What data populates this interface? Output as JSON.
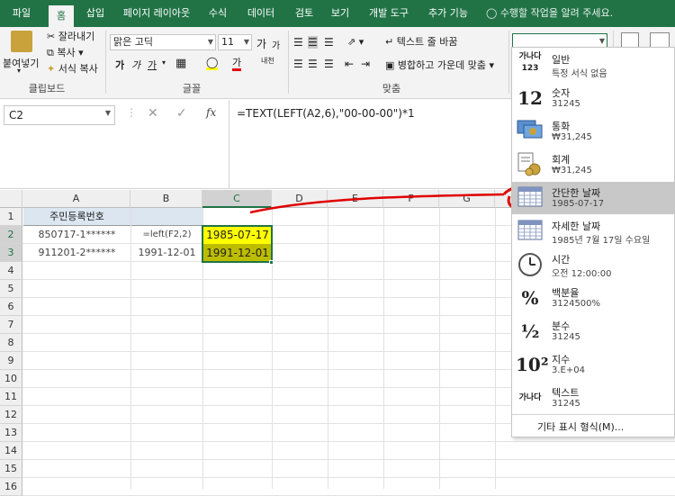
{
  "ribbon_tabs": [
    "파일",
    "홈",
    "삽입",
    "페이지 레이아웃",
    "수식",
    "데이터",
    "검토",
    "보기",
    "개발 도구",
    "추가 기능"
  ],
  "tell_me": "수행할 작업을 알려 주세요.",
  "clipboard": {
    "paste": "붙여넣기",
    "cut": "잘라내기",
    "copy": "복사",
    "format_painter": "서식 복사",
    "group": "클립보드"
  },
  "font": {
    "name": "맑은 고딕",
    "size": "11",
    "group": "글꼴",
    "bold": "가",
    "italic": "가",
    "underline": "가",
    "grow": "가",
    "shrink": "가",
    "fill_label": "가",
    "ruby": "내천"
  },
  "alignment": {
    "wrap": "텍스트 줄 바꿈",
    "merge": "병합하고 가운데 맞춤",
    "group": "맞춤"
  },
  "name_box": "C2",
  "formula": "=TEXT(LEFT(A2,6),\"00-00-00\")*1",
  "columns": [
    "A",
    "B",
    "C",
    "D",
    "E",
    "F",
    "G"
  ],
  "rows": [
    "1",
    "2",
    "3",
    "4",
    "5",
    "6",
    "7",
    "8",
    "9",
    "10",
    "11",
    "12",
    "13",
    "14",
    "15",
    "16"
  ],
  "cells": {
    "A1": "주민등록번호",
    "A2": "850717-1******",
    "A3": "911201-2******",
    "B2": "=left(F2,2)",
    "B3": "1991-12-01",
    "C2": "1985-07-17",
    "C3": "1991-12-01"
  },
  "colors": {
    "excel_green": "#217346",
    "header_blue": "#dce6f1",
    "highlight_yellow": "#ffff00",
    "annotation_red": "#e00000"
  },
  "number_formats": [
    {
      "icon": "가나다 123",
      "name": "일반",
      "example": "특정 서식 없음"
    },
    {
      "icon": "12",
      "name": "숫자",
      "example": "31245"
    },
    {
      "icon": "currency-icon",
      "name": "통화",
      "example": "₩31,245"
    },
    {
      "icon": "accounting-icon",
      "name": "회계",
      "example": "₩31,245"
    },
    {
      "icon": "calendar-icon",
      "name": "간단한 날짜",
      "example": "1985-07-17",
      "selected": true
    },
    {
      "icon": "calendar-icon",
      "name": "자세한 날짜",
      "example": "1985년 7월 17일 수요일"
    },
    {
      "icon": "clock-icon",
      "name": "시간",
      "example": "오전 12:00:00"
    },
    {
      "icon": "%",
      "name": "백분율",
      "example": "3124500%"
    },
    {
      "icon": "½",
      "name": "분수",
      "example": "31245"
    },
    {
      "icon": "10²",
      "name": "지수",
      "example": "3.E+04"
    },
    {
      "icon": "가나다",
      "name": "텍스트",
      "example": "31245"
    }
  ],
  "more_formats": "기타 표시 형식(M)..."
}
